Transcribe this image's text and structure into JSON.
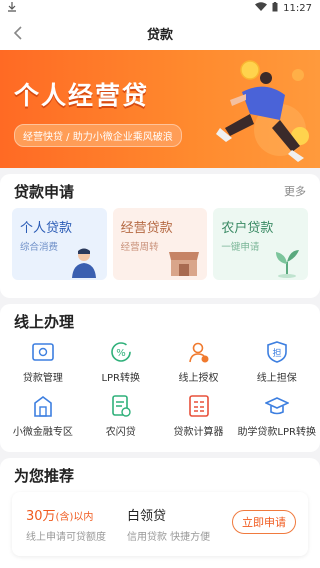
{
  "status": {
    "time": "11:27"
  },
  "nav": {
    "title": "贷款"
  },
  "banner": {
    "headline": "个人经营贷",
    "slogan": "经营快贷 / 助力小微企业乘风破浪"
  },
  "apply": {
    "title": "贷款申请",
    "more": "更多",
    "cards": [
      {
        "title": "个人贷款",
        "sub": "综合消费"
      },
      {
        "title": "经营贷款",
        "sub": "经营周转"
      },
      {
        "title": "农户贷款",
        "sub": "一键申请"
      }
    ]
  },
  "online": {
    "title": "线上办理",
    "items": [
      {
        "label": "贷款管理",
        "icon": "loan-manage-icon"
      },
      {
        "label": "LPR转换",
        "icon": "percent-convert-icon"
      },
      {
        "label": "线上授权",
        "icon": "user-auth-icon"
      },
      {
        "label": "线上担保",
        "icon": "shield-guarantee-icon"
      },
      {
        "label": "小微金融专区",
        "icon": "building-icon"
      },
      {
        "label": "农闪贷",
        "icon": "document-icon"
      },
      {
        "label": "贷款计算器",
        "icon": "calculator-icon"
      },
      {
        "label": "助学贷款LPR转换",
        "icon": "graduation-cap-icon"
      }
    ]
  },
  "recommend": {
    "title": "为您推荐",
    "amount": "30万",
    "amount_suffix": "(含)以内",
    "amount_desc": "线上申请可贷额度",
    "product": "白领贷",
    "product_desc": "信用贷款 快捷方便",
    "button": "立即申请"
  },
  "colors": {
    "accent": "#f05a1e",
    "blue": "#3d7fe0"
  }
}
